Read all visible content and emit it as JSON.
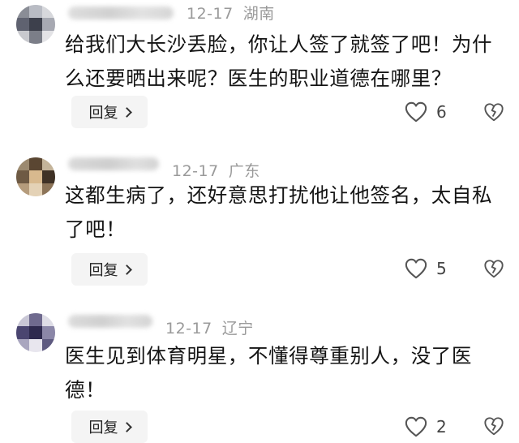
{
  "reply_label": "回复",
  "comments": [
    {
      "date": "12-17",
      "location": "湖南",
      "text": "给我们大长沙丢脸，你让人签了就签了吧！为什么还要晒出来呢？医生的职业道德在哪里？",
      "likes": "6"
    },
    {
      "date": "12-17",
      "location": "广东",
      "text": "这都生病了，还好意思打扰他让他签名，太自私了吧！",
      "likes": "5"
    },
    {
      "date": "12-17",
      "location": "辽宁",
      "text": "医生见到体育明星，不懂得尊重别人，没了医德！",
      "likes": "2"
    }
  ],
  "icons": {
    "like": "heart-outline-icon",
    "dislike": "broken-heart-icon",
    "reply_chevron": "chevron-right-icon"
  }
}
